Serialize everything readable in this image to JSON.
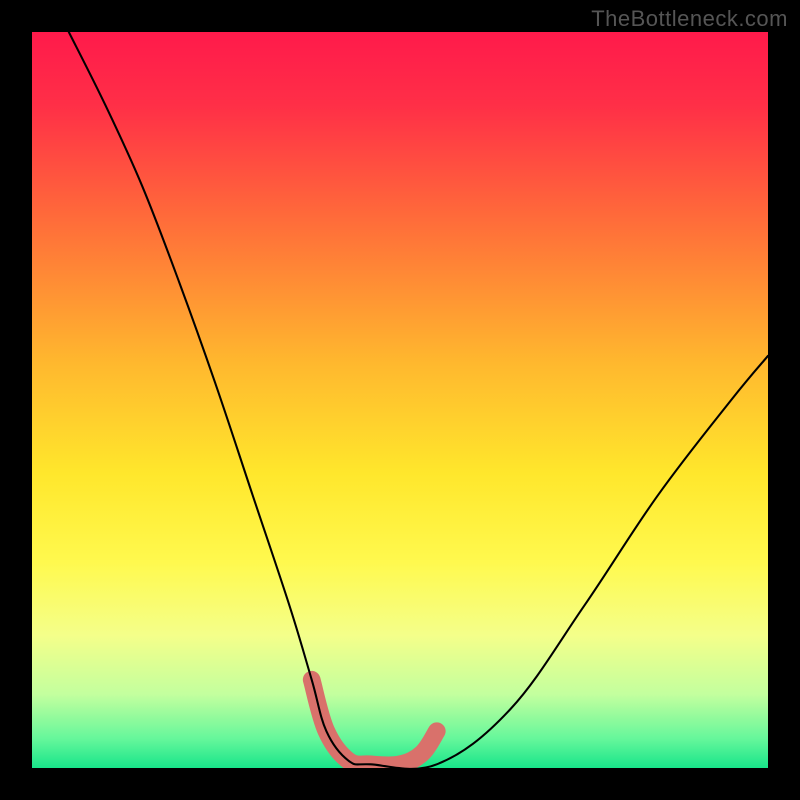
{
  "watermark": "TheBottleneck.com",
  "chart_data": {
    "type": "line",
    "title": "",
    "xlabel": "",
    "ylabel": "",
    "xlim": [
      0,
      100
    ],
    "ylim": [
      0,
      100
    ],
    "grid": false,
    "legend": false,
    "notes": "V-shaped bottleneck curve; no axis ticks or labels are shown in the image. Values are rough visual estimates of the black curve position as percent of plot width (x) vs percent of plot height from bottom (y).",
    "series": [
      {
        "name": "bottleneck-curve",
        "color": "#000000",
        "x": [
          5,
          10,
          15,
          20,
          25,
          30,
          35,
          38,
          40,
          43,
          46,
          55,
          65,
          75,
          85,
          95,
          100
        ],
        "y": [
          100,
          90,
          79,
          66,
          52,
          37,
          22,
          12,
          5,
          1,
          0.5,
          0.5,
          8,
          22,
          37,
          50,
          56
        ]
      },
      {
        "name": "highlight-segment",
        "color": "#d9716b",
        "x": [
          38,
          40,
          43,
          46,
          50,
          53,
          55
        ],
        "y": [
          12,
          5,
          1,
          0.5,
          0.5,
          2,
          5
        ]
      }
    ],
    "gradient": {
      "stops": [
        {
          "offset": 0.0,
          "color": "#ff1a4b"
        },
        {
          "offset": 0.1,
          "color": "#ff2f47"
        },
        {
          "offset": 0.25,
          "color": "#ff6a3a"
        },
        {
          "offset": 0.45,
          "color": "#ffb82e"
        },
        {
          "offset": 0.6,
          "color": "#ffe72c"
        },
        {
          "offset": 0.72,
          "color": "#fff94e"
        },
        {
          "offset": 0.82,
          "color": "#f4ff8a"
        },
        {
          "offset": 0.9,
          "color": "#c3ff9e"
        },
        {
          "offset": 0.96,
          "color": "#66f79b"
        },
        {
          "offset": 1.0,
          "color": "#18e58a"
        }
      ]
    }
  }
}
